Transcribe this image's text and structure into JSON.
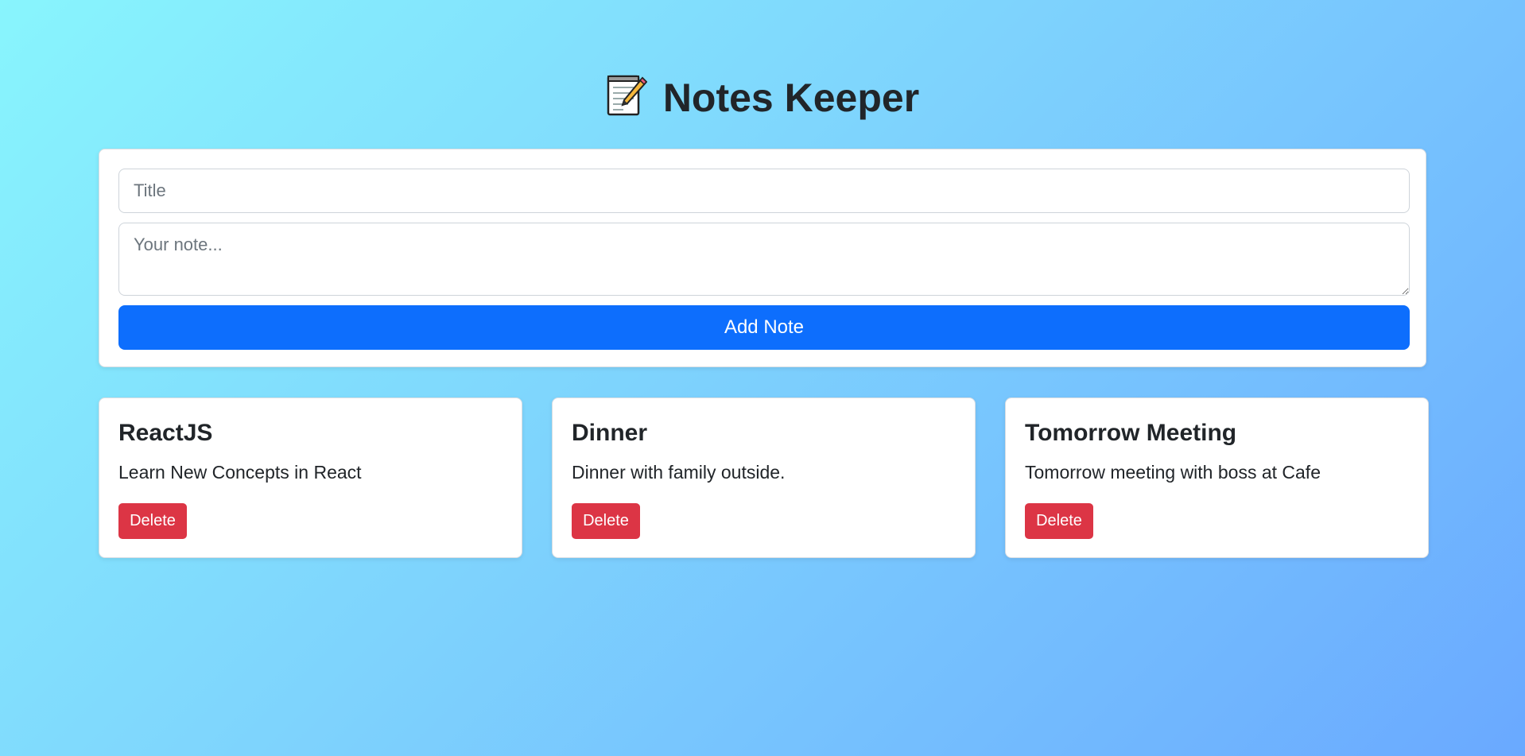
{
  "header": {
    "title": "Notes Keeper",
    "icon": "notepad-pencil-icon"
  },
  "form": {
    "title_placeholder": "Title",
    "title_value": "",
    "note_placeholder": "Your note...",
    "note_value": "",
    "add_label": "Add Note"
  },
  "notes": [
    {
      "title": "ReactJS",
      "text": "Learn New Concepts in React",
      "delete_label": "Delete"
    },
    {
      "title": "Dinner",
      "text": "Dinner with family outside.",
      "delete_label": "Delete"
    },
    {
      "title": "Tomorrow Meeting",
      "text": "Tomorrow meeting with boss at Cafe",
      "delete_label": "Delete"
    }
  ],
  "colors": {
    "primary": "#0d6efd",
    "danger": "#dc3545",
    "background_start": "#88f5fd",
    "background_end": "#6aa9ff"
  }
}
